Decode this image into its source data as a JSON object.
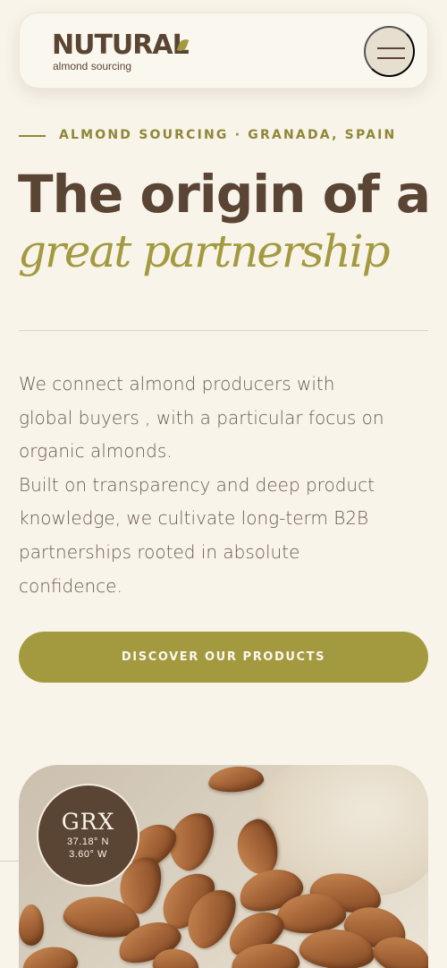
{
  "header": {
    "logo_word": "NUTURAL",
    "logo_sub": "almond sourcing",
    "menu_icon": "hamburger-menu-icon"
  },
  "hero": {
    "eyebrow": "ALMOND SOURCING · GRANADA, SPAIN",
    "title": "The origin of a",
    "title_accent": "great partnership",
    "intro_lines": [
      "We connect almond producers with",
      "global buyers , with a particular focus on",
      "organic almonds.",
      "Built on transparency and deep product",
      "knowledge, we cultivate long-term B2B",
      "partnerships rooted in absolute",
      "confidence."
    ],
    "cta_label": "DISCOVER OUR PRODUCTS"
  },
  "origin_badge": {
    "code": "GRX",
    "lat": "37.18° N",
    "lon": "3.60° W"
  },
  "colors": {
    "background": "#f8f4ea",
    "brand_brown": "#5a4434",
    "accent_olive": "#a39a40"
  }
}
